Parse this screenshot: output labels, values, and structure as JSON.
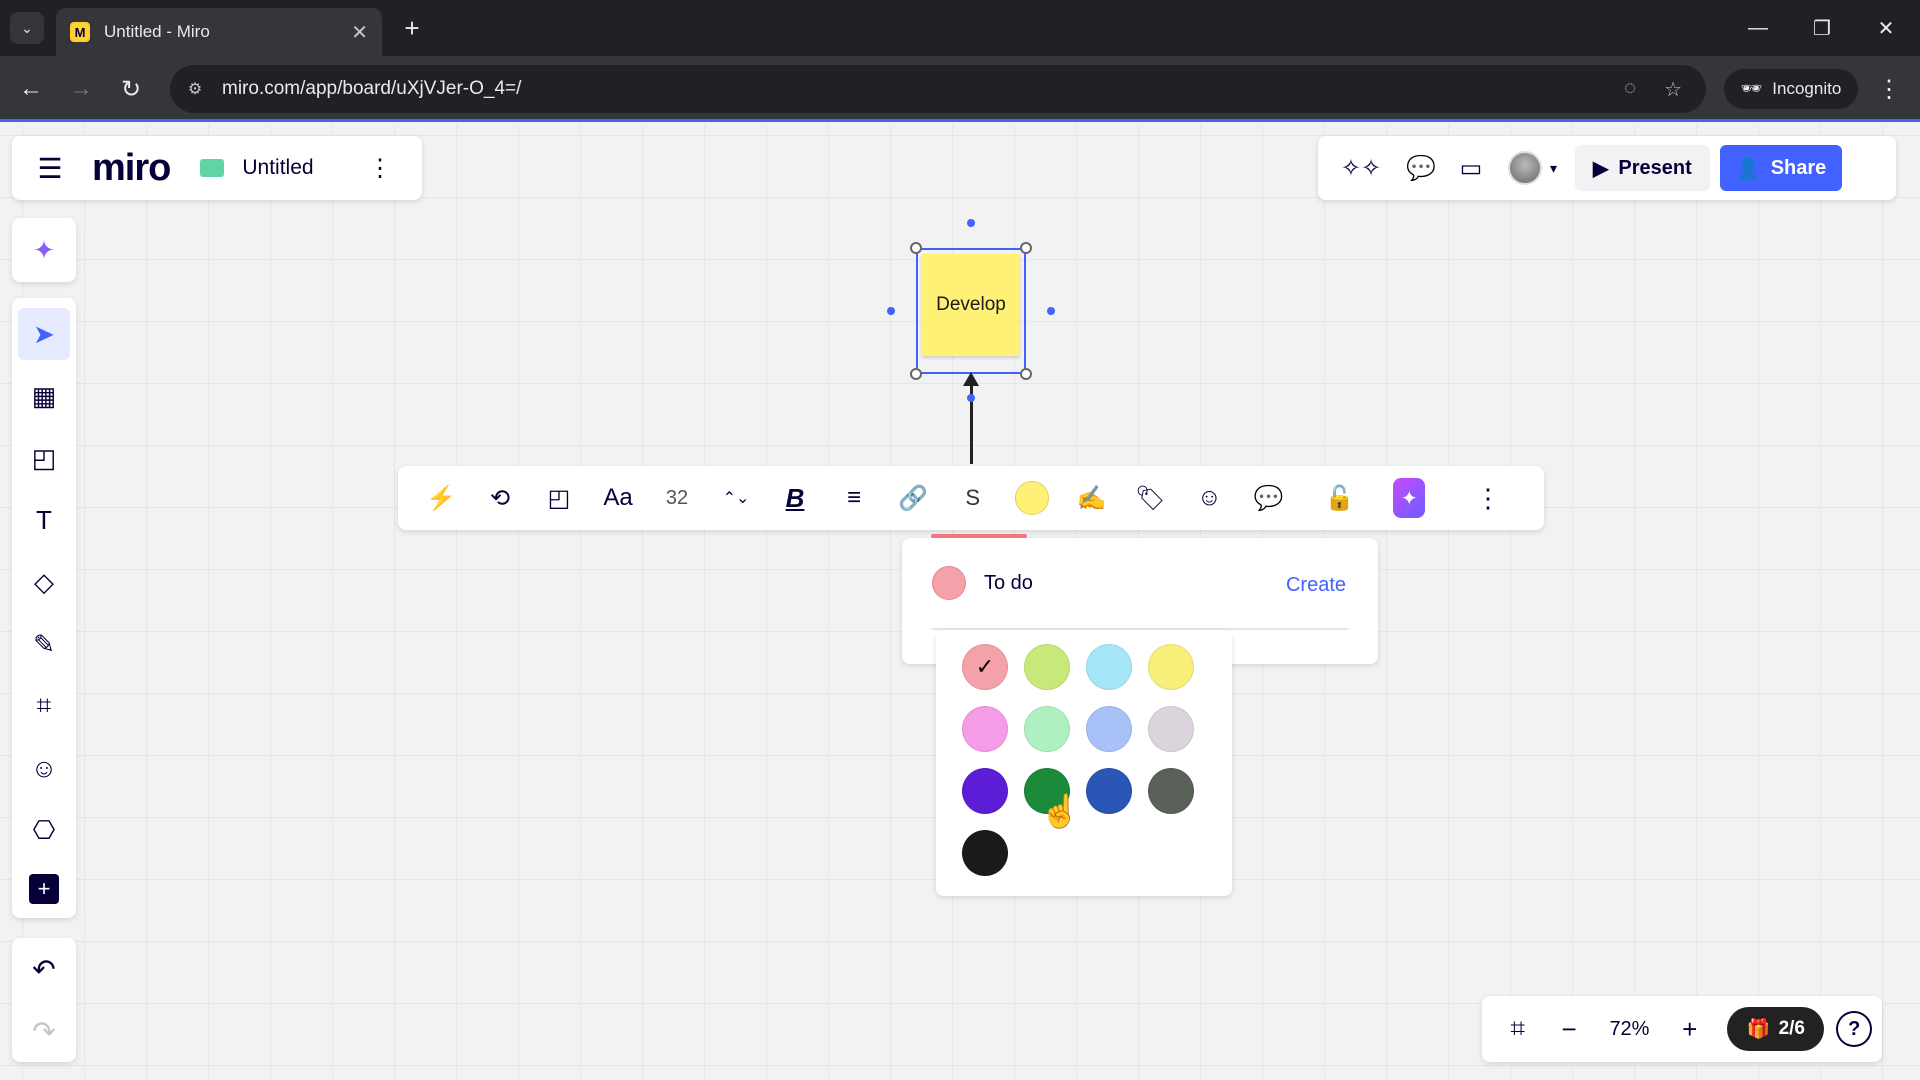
{
  "browser": {
    "tab_title": "Untitled - Miro",
    "favicon_letter": "M",
    "url": "miro.com/app/board/uXjVJer-O_4=/",
    "incognito_label": "Incognito"
  },
  "header": {
    "logo": "miro",
    "board_title": "Untitled",
    "present_label": "Present",
    "share_label": "Share"
  },
  "sticky": {
    "text": "Develop",
    "color": "#fff176"
  },
  "context_toolbar": {
    "font_size": "32",
    "tag_button_label": "S",
    "sticky_color": "#fff176"
  },
  "tag_popup": {
    "input_value": "To do",
    "create_label": "Create",
    "tag_color": "#f4a1a9"
  },
  "color_picker": {
    "selected": "#f4a1a9",
    "swatches": [
      "#f4a1a9",
      "#c8e97a",
      "#a7e5f8",
      "#f8ef7a",
      "#f49ce8",
      "#aef0c0",
      "#a8c1f8",
      "#dcd4dc",
      "#5b1ed6",
      "#1b8a3a",
      "#2a56b8",
      "#5a6158",
      "#1a1a1a"
    ]
  },
  "zoom": {
    "level": "72%",
    "pages": "2/6"
  }
}
